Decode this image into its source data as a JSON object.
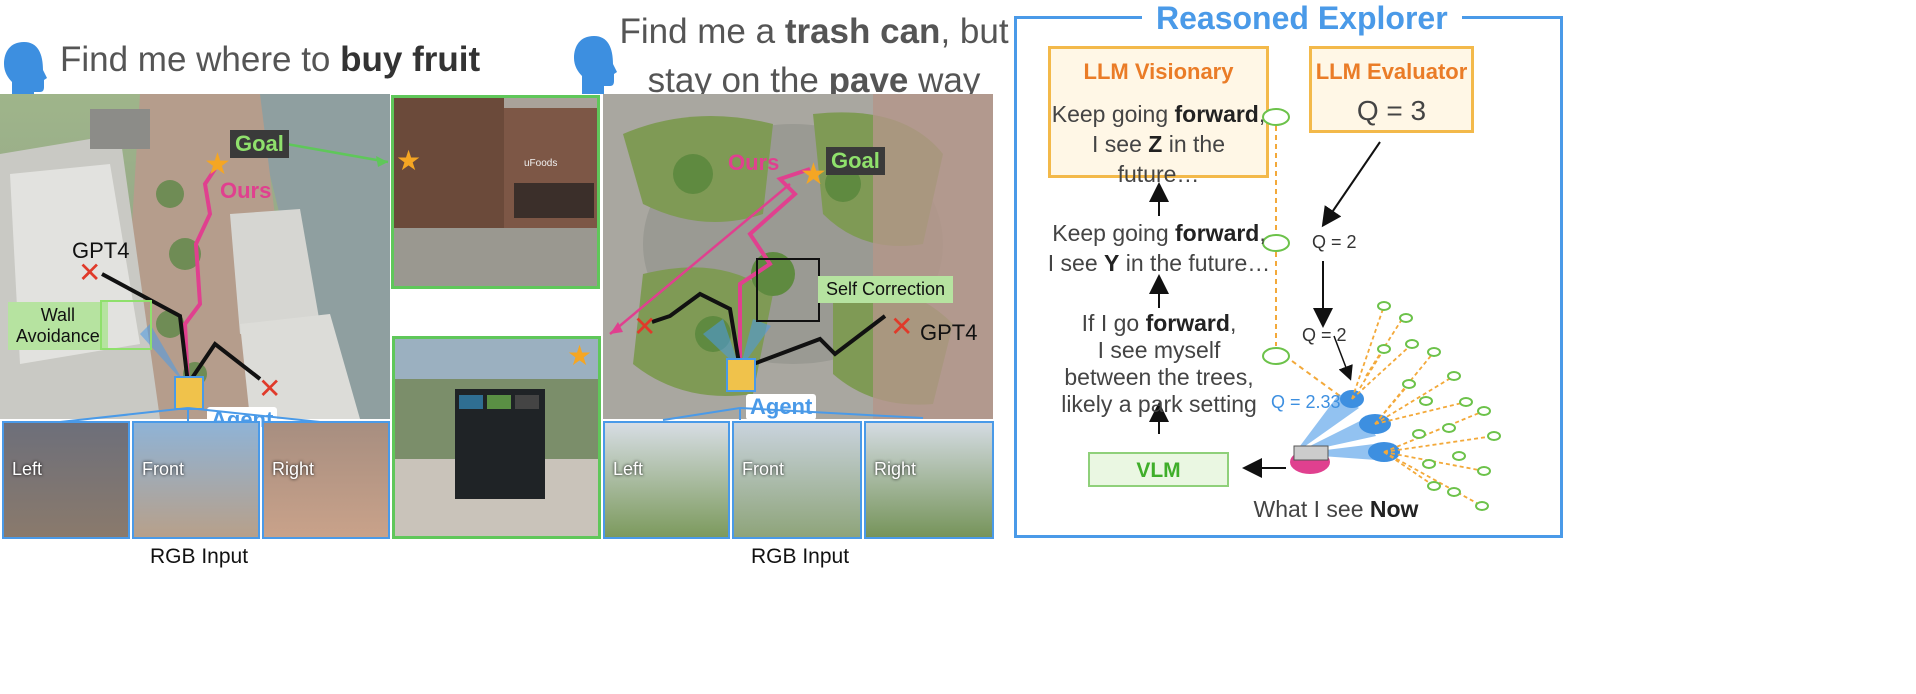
{
  "colors": {
    "accent_blue": "#4a9ae8",
    "accent_orange": "#ea7c27",
    "accent_green": "#3fae2a",
    "path_pink": "#e0408f",
    "scene_green_border": "#5fc75a"
  },
  "left_scenario": {
    "prompt_pre": "Find me where to ",
    "prompt_bold": "buy fruit",
    "goal_label": "Goal",
    "ours_label": "Ours",
    "gpt4_label": "GPT4",
    "wall_avoidance_line1": "Wall",
    "wall_avoidance_line2": "Avoidance",
    "agent_label": "Agent",
    "views": [
      "Left",
      "Front",
      "Right"
    ],
    "rgb_caption": "RGB Input",
    "storefront_sign": "uFoods",
    "icons": [
      "human-head-icon",
      "star-icon",
      "x-mark-icon",
      "robot-agent-icon"
    ]
  },
  "right_scenario": {
    "prompt_line1_pre": "Find me a ",
    "prompt_line1_bold": "trash can",
    "prompt_line1_post": ", but",
    "prompt_line2_pre": "stay on the ",
    "prompt_line2_bold": "pave",
    "prompt_line2_post": " way",
    "goal_label": "Goal",
    "ours_label": "Ours",
    "gpt4_label": "GPT4",
    "self_correction_label": "Self Correction",
    "agent_label": "Agent",
    "views": [
      "Left",
      "Front",
      "Right"
    ],
    "rgb_caption": "RGB Input"
  },
  "explorer": {
    "title": "Reasoned Explorer",
    "visionary": {
      "title": "LLM Visionary",
      "line1_pre": "Keep going ",
      "line1_bold": "forward",
      "line1_post": ",",
      "line2_pre": "I see ",
      "line2_bold": "Z",
      "line2_post": " in the future…"
    },
    "evaluator": {
      "title": "LLM Evaluator",
      "value": "Q = 3"
    },
    "step_y": {
      "line1_pre": "Keep going ",
      "line1_bold": "forward",
      "line1_post": ",",
      "line2_pre": "I see ",
      "line2_bold": "Y",
      "line2_post": " in the future…"
    },
    "step_x": {
      "line1_pre": "If I go ",
      "line1_bold": "forward",
      "line1_post": ",",
      "line2": "I see myself",
      "line3": "between the trees,",
      "line4": "likely a park setting"
    },
    "vlm_label": "VLM",
    "now_pre": "What I see ",
    "now_bold": "Now",
    "q_values": [
      "Q = 2",
      "Q = 2",
      "Q = 2.33"
    ]
  }
}
